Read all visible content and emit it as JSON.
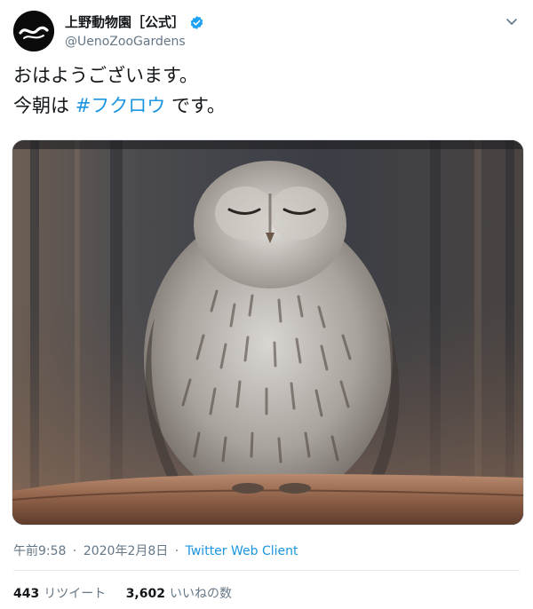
{
  "account": {
    "display_name": "上野動物園［公式］",
    "handle": "@UenoZooGardens",
    "verified_icon": "verified-badge-icon",
    "avatar_icon": "zoo-logo-icon",
    "menu_icon": "chevron-down-icon"
  },
  "tweet": {
    "line1": "おはようございます。",
    "line2_prefix": "今朝は ",
    "hashtag": "#フクロウ",
    "line2_suffix": " です。"
  },
  "media": {
    "subject": "owl-photo"
  },
  "meta": {
    "time": "午前9:58",
    "separator": "·",
    "date": "2020年2月8日",
    "source": "Twitter Web Client"
  },
  "stats": {
    "retweet_count": "443",
    "retweet_label": "リツイート",
    "like_count": "3,602",
    "like_label": "いいねの数"
  },
  "colors": {
    "link": "#1b95e0",
    "text": "#14171a",
    "muted": "#657786",
    "verified": "#1da1f2"
  }
}
